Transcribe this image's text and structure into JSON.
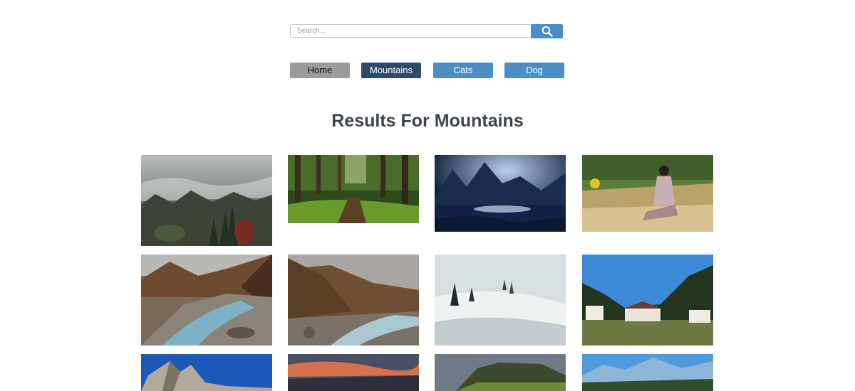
{
  "search": {
    "placeholder": "Search...",
    "value": "",
    "button_icon": "search-icon"
  },
  "nav": {
    "items": [
      {
        "label": "Home"
      },
      {
        "label": "Mountains",
        "active": true
      },
      {
        "label": "Cats"
      },
      {
        "label": "Dog"
      }
    ]
  },
  "results": {
    "title": "Results For Mountains"
  },
  "colors": {
    "accent": "#4a8ec4",
    "active_tab": "#2c4b69",
    "home_tab": "#9b9b9b",
    "title_text": "#3c4550"
  }
}
